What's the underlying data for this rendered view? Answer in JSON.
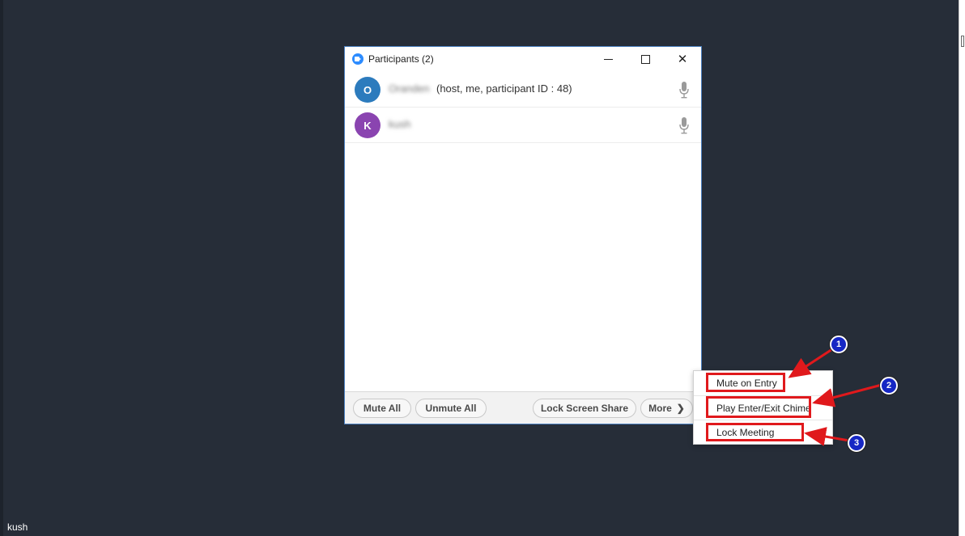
{
  "window": {
    "title": "Participants (2)",
    "buttons": {
      "minimize": "minimize-icon",
      "maximize": "maximize-icon",
      "close": "close-icon"
    }
  },
  "participants": [
    {
      "initial": "O",
      "name": "Oranden",
      "role": "(host, me, participant ID : 48)",
      "avatar_color": "#2c7bbd",
      "mic_icon": "microphone-icon"
    },
    {
      "initial": "K",
      "name": "kush",
      "role": "",
      "avatar_color": "#8a44b0",
      "mic_icon": "microphone-icon"
    }
  ],
  "footer": {
    "mute_all": "Mute All",
    "unmute_all": "Unmute All",
    "lock_screen_share": "Lock Screen Share",
    "more": "More"
  },
  "menu": {
    "items": [
      "Mute on Entry",
      "Play Enter/Exit Chime",
      "Lock Meeting"
    ]
  },
  "annotations": {
    "badges": [
      "1",
      "2",
      "3"
    ],
    "color": "#e0191c",
    "badge_color": "#1627c4"
  },
  "desktop": {
    "bottom_name": "kush"
  }
}
